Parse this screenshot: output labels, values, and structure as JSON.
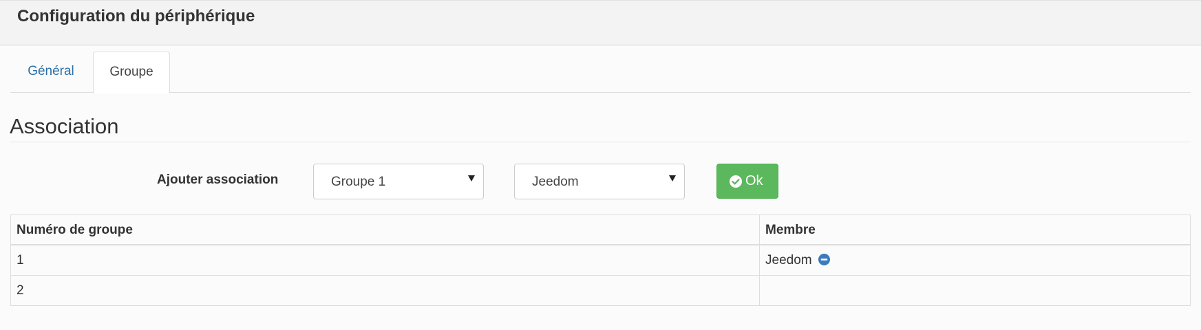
{
  "header": {
    "title": "Configuration du périphérique"
  },
  "tabs": [
    {
      "label": "Général",
      "active": false
    },
    {
      "label": "Groupe",
      "active": true
    }
  ],
  "section": {
    "title": "Association"
  },
  "form": {
    "label": "Ajouter association",
    "group_select": {
      "value": "Groupe 1"
    },
    "member_select": {
      "value": "Jeedom"
    },
    "ok_button": {
      "label": "Ok",
      "icon": "check-circle-icon"
    }
  },
  "table": {
    "columns": [
      "Numéro de groupe",
      "Membre"
    ],
    "rows": [
      {
        "group": "1",
        "member": "Jeedom",
        "action_icon": "minus-circle-icon"
      },
      {
        "group": "2",
        "member": ""
      }
    ]
  },
  "colors": {
    "accent_link": "#2a6fa8",
    "ok_button": "#5cb85c",
    "remove_icon": "#3a7bbf"
  }
}
